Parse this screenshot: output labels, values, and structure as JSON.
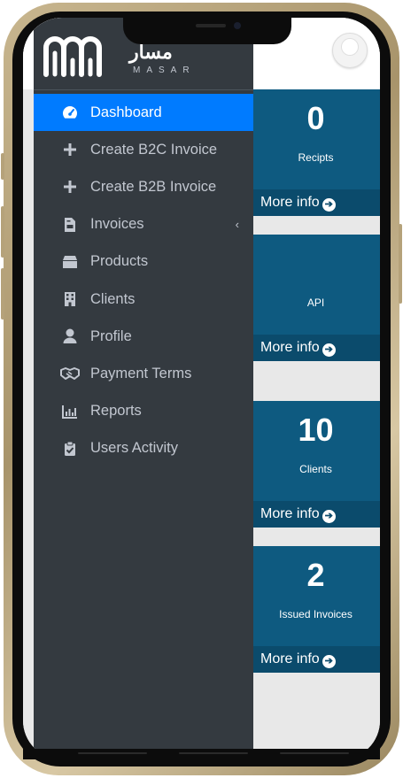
{
  "brand": {
    "arabic_name": "مسار",
    "english_name": "MASAR"
  },
  "sidebar": {
    "items": [
      {
        "label": "Dashboard",
        "icon": "tachometer-icon",
        "active": true
      },
      {
        "label": "Create B2C Invoice",
        "icon": "plus-icon"
      },
      {
        "label": "Create B2B Invoice",
        "icon": "plus-icon"
      },
      {
        "label": "Invoices",
        "icon": "file-invoice-icon",
        "has_submenu": true
      },
      {
        "label": "Products",
        "icon": "box-icon"
      },
      {
        "label": "Clients",
        "icon": "building-icon"
      },
      {
        "label": "Profile",
        "icon": "user-icon"
      },
      {
        "label": "Payment Terms",
        "icon": "handshake-icon"
      },
      {
        "label": "Reports",
        "icon": "chart-bar-icon"
      },
      {
        "label": "Users Activity",
        "icon": "clipboard-check-icon"
      }
    ],
    "chevron": "‹"
  },
  "cards": [
    {
      "value": "0",
      "label": "Recipts",
      "more": "More info"
    },
    {
      "value": "",
      "label": "API",
      "more": "More info"
    },
    {
      "value": "10",
      "label": "Clients",
      "more": "More info"
    },
    {
      "value": "2",
      "label": "Issued Invoices",
      "more": "More info"
    }
  ],
  "colors": {
    "sidebar_bg": "#343a40",
    "active_bg": "#007bff",
    "card_bg": "#0e5a80",
    "card_footer_bg": "#0b4b6c"
  }
}
